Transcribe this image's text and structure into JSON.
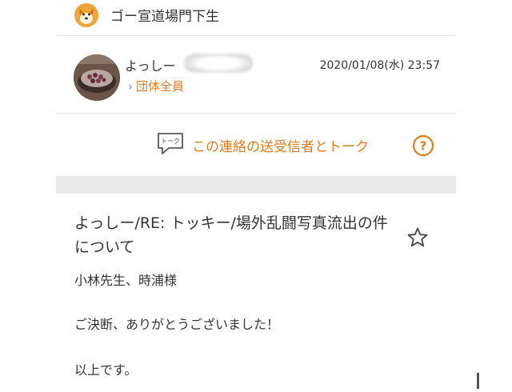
{
  "group": {
    "name": "ゴー宣道場門下生",
    "avatar_icon": "dog-face-icon"
  },
  "sender": {
    "name": "よっしー",
    "group_label": "団体全員",
    "date": "2020/01/08(水) 23:57",
    "avatar_icon": "photo-avatar"
  },
  "talk": {
    "label": "この連絡の送受信者とトーク",
    "icon_text": "トーク",
    "help_icon": "question-circle-icon"
  },
  "message": {
    "title": "よっしー/RE: トッキー/場外乱闘写真流出の件について",
    "lines": [
      "小林先生、時浦様",
      "ご決断、ありがとうございました！",
      "以上です。"
    ]
  },
  "colors": {
    "accent": "#e27b1c",
    "divider": "#e2e2e2",
    "band": "#e9e9e9"
  }
}
